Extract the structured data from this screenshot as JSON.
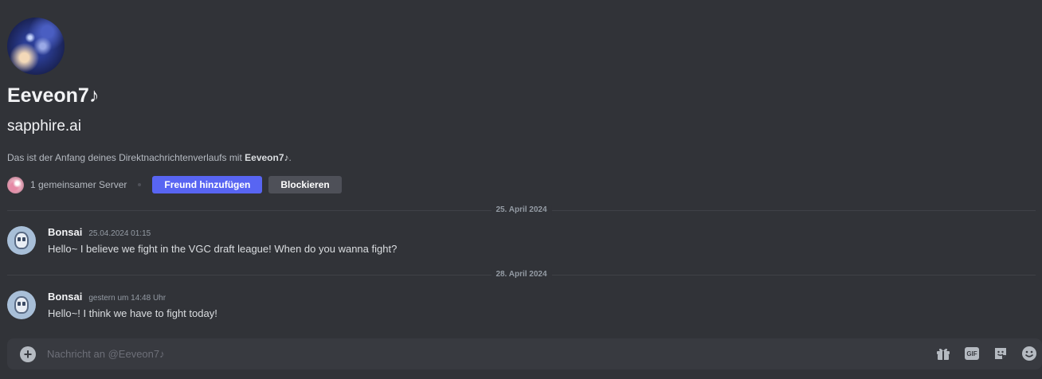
{
  "profile": {
    "display_name": "Eeveon7♪",
    "username": "sapphire.ai",
    "intro_prefix": "Das ist der Anfang deines Direktnachrichtenverlaufs mit ",
    "intro_name": "Eeveon7♪",
    "intro_suffix": ".",
    "mutual_servers": "1 gemeinsamer Server",
    "add_friend_label": "Freund hinzufügen",
    "block_label": "Blockieren"
  },
  "messages": [
    {
      "date_divider": "25. April 2024",
      "author": "Bonsai",
      "timestamp": "25.04.2024 01:15",
      "text": "Hello~ I believe we fight in the VGC draft league! When do you wanna fight?"
    },
    {
      "date_divider": "28. April 2024",
      "author": "Bonsai",
      "timestamp": "gestern um 14:48 Uhr",
      "text": "Hello~! I think we have to fight today!"
    }
  ],
  "composer": {
    "placeholder": "Nachricht an @Eeveon7♪",
    "gif_label": "GIF",
    "icons": [
      "add-circle-icon",
      "gift-icon",
      "gif-icon",
      "sticker-icon",
      "emoji-icon"
    ]
  },
  "colors": {
    "background": "#313338",
    "composer": "#383a40",
    "primary_button": "#5865f2",
    "secondary_button": "#4e5058"
  }
}
